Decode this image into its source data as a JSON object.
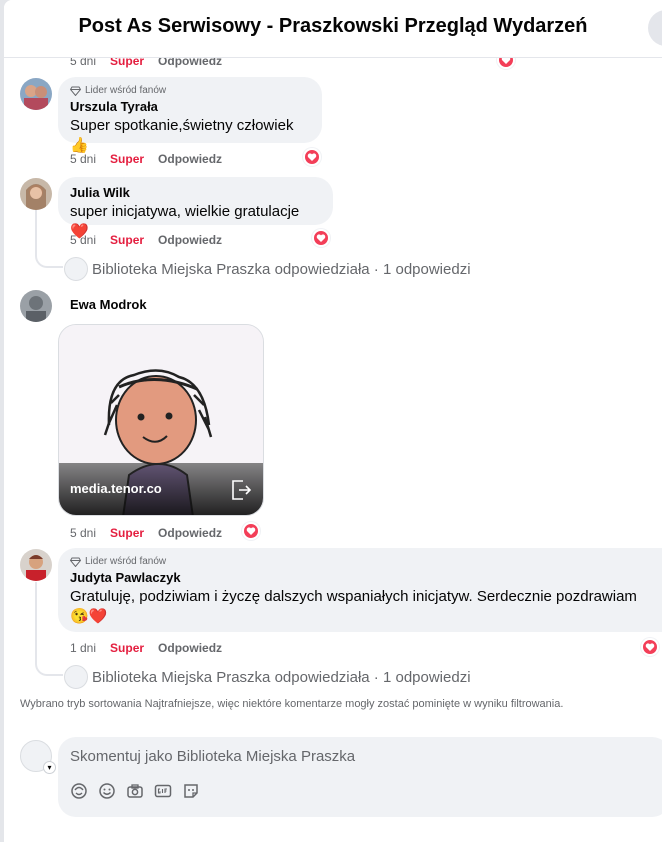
{
  "header": {
    "title": "Post As Serwisowy - Praszkowski Przegląd Wydarzeń"
  },
  "actions": {
    "like": "Super",
    "reply": "Odpowiedz"
  },
  "top_meta": {
    "time": "5 dni"
  },
  "comments": [
    {
      "badge": "Lider wśród fanów",
      "author": "Urszula Tyrała",
      "text": "Super spotkanie,świetny człowiek 👍",
      "time": "5 dni"
    },
    {
      "author": "Julia Wilk",
      "text": "super inicjatywa, wielkie gratulacje ❤️",
      "time": "5 dni"
    },
    {
      "author": "Ewa Modrok",
      "gif_source": "media.tenor.co",
      "time": "5 dni"
    },
    {
      "badge": "Lider wśród fanów",
      "author": "Judyta Pawlaczyk",
      "text_line1": "Gratuluję, podziwiam i życzę dalszych wspaniałych inicjatyw. Serdecznie pozdrawiam",
      "text_line2": "😘❤️",
      "time": "1 dni"
    }
  ],
  "reply_summaries": [
    "Biblioteka Miejska Praszka odpowiedziała · 1 odpowiedzi",
    "Biblioteka Miejska Praszka odpowiedziała · 1 odpowiedzi"
  ],
  "sort_note": "Wybrano tryb sortowania Najtrafniejsze, więc niektóre komentarze mogły zostać pominięte w wyniku filtrowania.",
  "composer": {
    "placeholder": "Skomentuj jako Biblioteka Miejska Praszka"
  },
  "icons": [
    "diamond-icon",
    "heart-reaction-icon",
    "close-icon",
    "share-icon",
    "avatar-sticker-icon",
    "emoji-icon",
    "camera-icon",
    "gif-icon",
    "sticker-icon"
  ],
  "colors": {
    "like": "#e41e3f",
    "heart": "#f33e58",
    "bubble": "#f0f2f5",
    "muted": "#65676b"
  }
}
